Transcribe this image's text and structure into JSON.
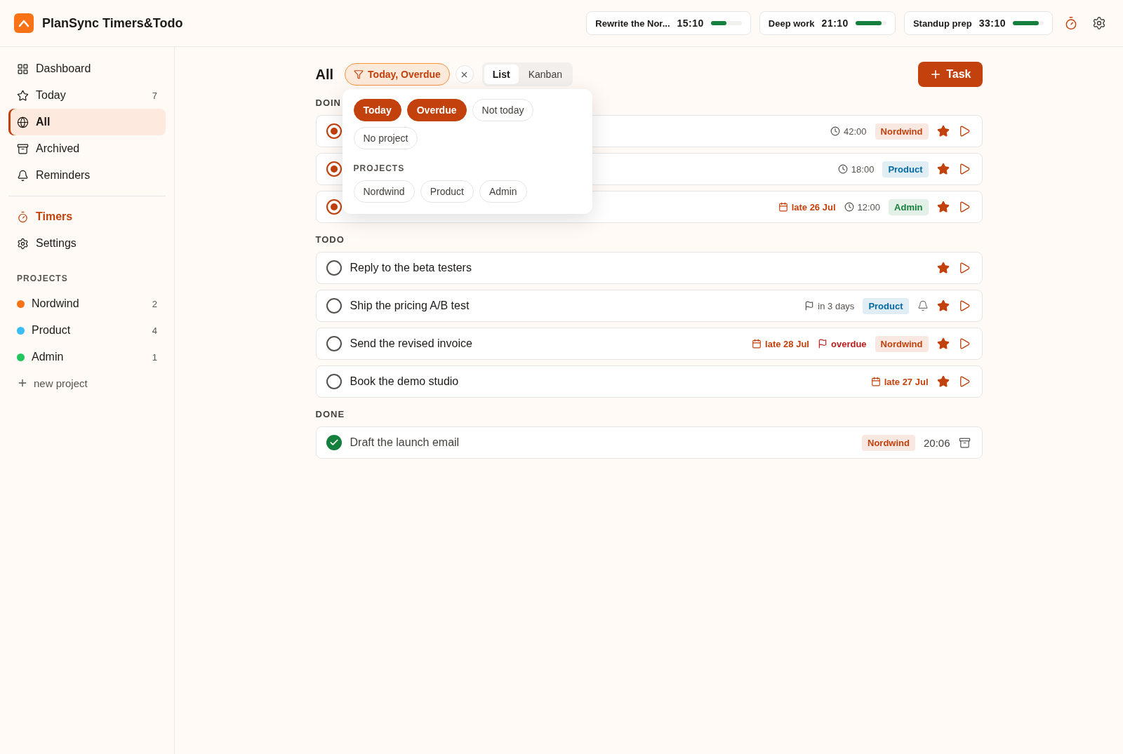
{
  "app": {
    "title": "PlanSync Timers&Todo"
  },
  "timers": [
    {
      "title": "Rewrite the Nor...",
      "time": "15:10",
      "level": 0.5
    },
    {
      "title": "Deep work",
      "time": "21:10",
      "level": 0.85
    },
    {
      "title": "Standup prep",
      "time": "33:10",
      "level": 0.85
    }
  ],
  "sidebar": {
    "items": [
      {
        "label": "Dashboard",
        "selected": false
      },
      {
        "label": "Today",
        "count": "7",
        "selected": false
      },
      {
        "label": "All",
        "selected": true
      },
      {
        "label": "Archived",
        "selected": false
      },
      {
        "label": "Reminders",
        "selected": false
      }
    ],
    "secondary": [
      {
        "label": "Timers",
        "accent": true
      },
      {
        "label": "Settings",
        "accent": false
      }
    ],
    "projects_heading": "PROJECTS",
    "projects": [
      {
        "label": "Nordwind",
        "count": "2",
        "color": "#f97316"
      },
      {
        "label": "Product",
        "count": "4",
        "color": "#38bdf8"
      },
      {
        "label": "Admin",
        "count": "1",
        "color": "#22c55e"
      }
    ],
    "new_project": "new project"
  },
  "toolbar": {
    "title": "All",
    "filter": "Today, Overdue",
    "views": [
      {
        "label": "List",
        "selected": true
      },
      {
        "label": "Kanban",
        "selected": false
      }
    ],
    "add_button": "Task"
  },
  "filter_popover": {
    "options": [
      {
        "label": "Today",
        "selected": true
      },
      {
        "label": "Overdue",
        "selected": true
      },
      {
        "label": "Not today",
        "selected": false
      },
      {
        "label": "No project",
        "selected": false
      }
    ],
    "projects_heading": "PROJECTS",
    "projects": [
      {
        "label": "Nordwind",
        "selected": false
      },
      {
        "label": "Product",
        "selected": false
      },
      {
        "label": "Admin",
        "selected": false
      }
    ]
  },
  "sections": [
    {
      "heading": "DOIN",
      "rows": [
        {
          "kind": "doing",
          "duration": "42:00",
          "tag": {
            "label": "Nordwind",
            "color": "#c2410c"
          },
          "starred": true
        },
        {
          "kind": "doing",
          "duration": "18:00",
          "tag": {
            "label": "Product",
            "color": "#0369a1"
          },
          "starred": true
        },
        {
          "kind": "doing",
          "late": "late 26 Jul",
          "duration": "12:00",
          "tag": {
            "label": "Admin",
            "color": "#15803d"
          },
          "starred": true
        }
      ]
    },
    {
      "heading": "TODO",
      "rows": [
        {
          "kind": "todo",
          "title": "Reply to the beta testers",
          "starred": true
        },
        {
          "kind": "todo",
          "title": "Ship the pricing A/B test",
          "deadline": {
            "label": "in 3 days",
            "overdue": false
          },
          "tag": {
            "label": "Product",
            "color": "#0369a1"
          },
          "reminder": true,
          "starred": true
        },
        {
          "kind": "todo",
          "title": "Send the revised invoice",
          "late": "late 28 Jul",
          "deadline": {
            "label": "overdue",
            "overdue": true
          },
          "tag": {
            "label": "Nordwind",
            "color": "#c2410c"
          },
          "starred": true
        },
        {
          "kind": "todo",
          "title": "Book the demo studio",
          "late": "late 27 Jul",
          "starred": true
        }
      ]
    },
    {
      "heading": "DONE",
      "rows": [
        {
          "kind": "done",
          "title": "Draft the launch email",
          "tag": {
            "label": "Nordwind",
            "color": "#c2410c"
          },
          "done_time": "20:06"
        }
      ]
    }
  ]
}
